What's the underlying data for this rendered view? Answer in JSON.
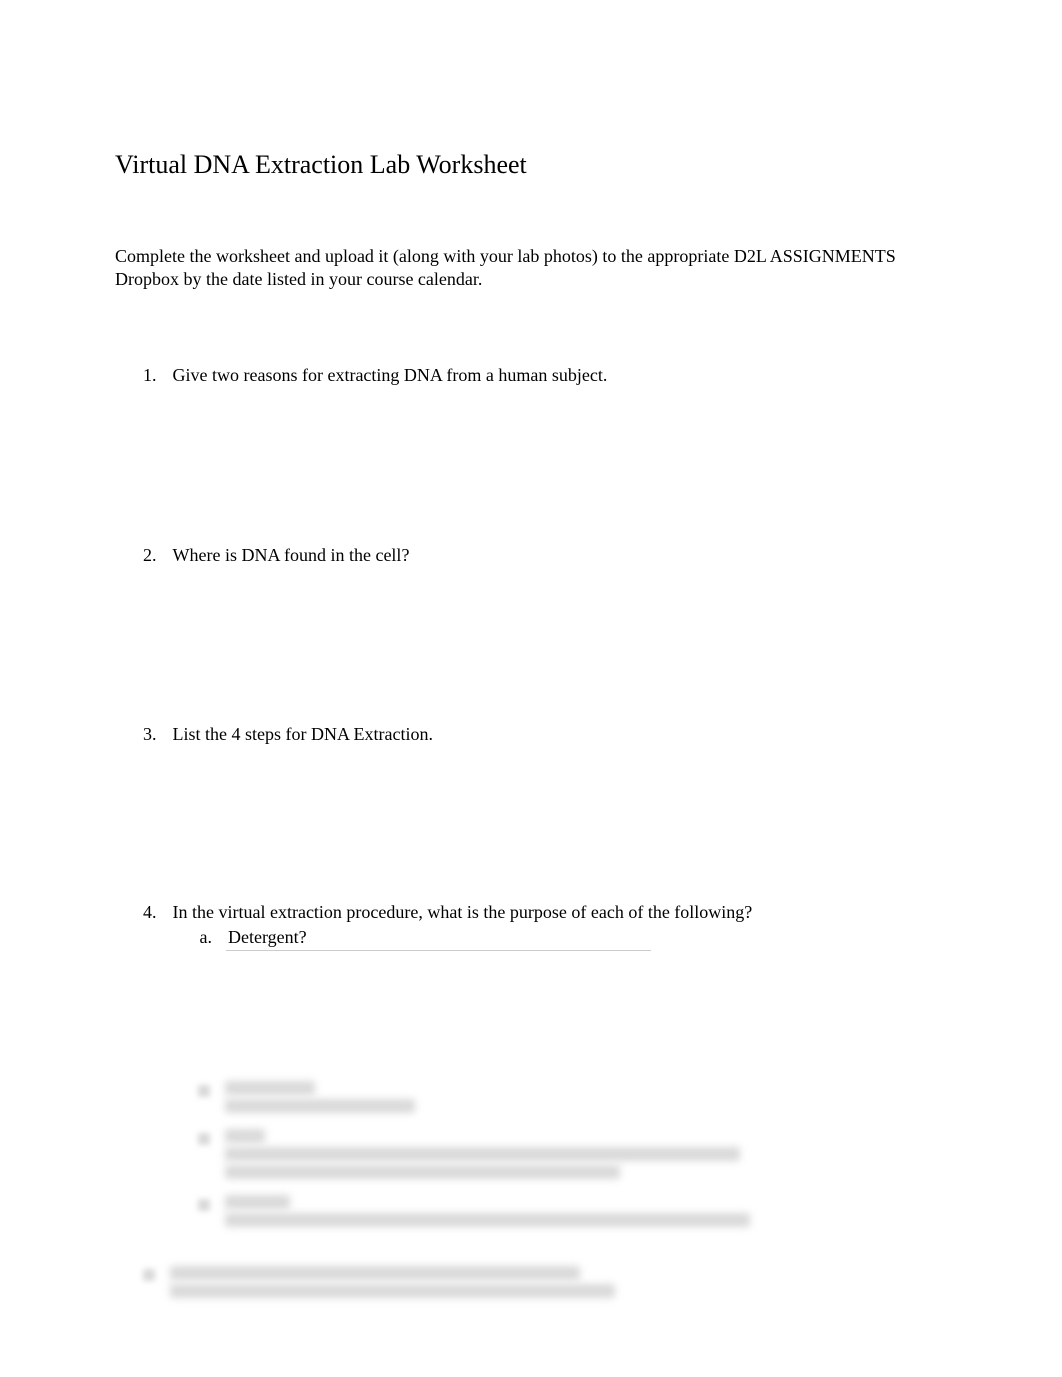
{
  "title": "Virtual DNA Extraction Lab Worksheet",
  "instructions": "Complete the worksheet and upload it (along with your lab photos) to the appropriate D2L ASSIGNMENTS Dropbox by the date listed in your course calendar.",
  "questions": [
    {
      "number": "1.",
      "text": "Give two reasons for extracting DNA from a human subject."
    },
    {
      "number": "2.",
      "text": "Where is DNA found in the cell?"
    },
    {
      "number": "3.",
      "text": "List the 4 steps for DNA Extraction."
    },
    {
      "number": "4.",
      "text": "In the virtual extraction procedure, what is the purpose of each of the following?",
      "sub": {
        "letter": "a.",
        "text": "Detergent?"
      }
    }
  ]
}
